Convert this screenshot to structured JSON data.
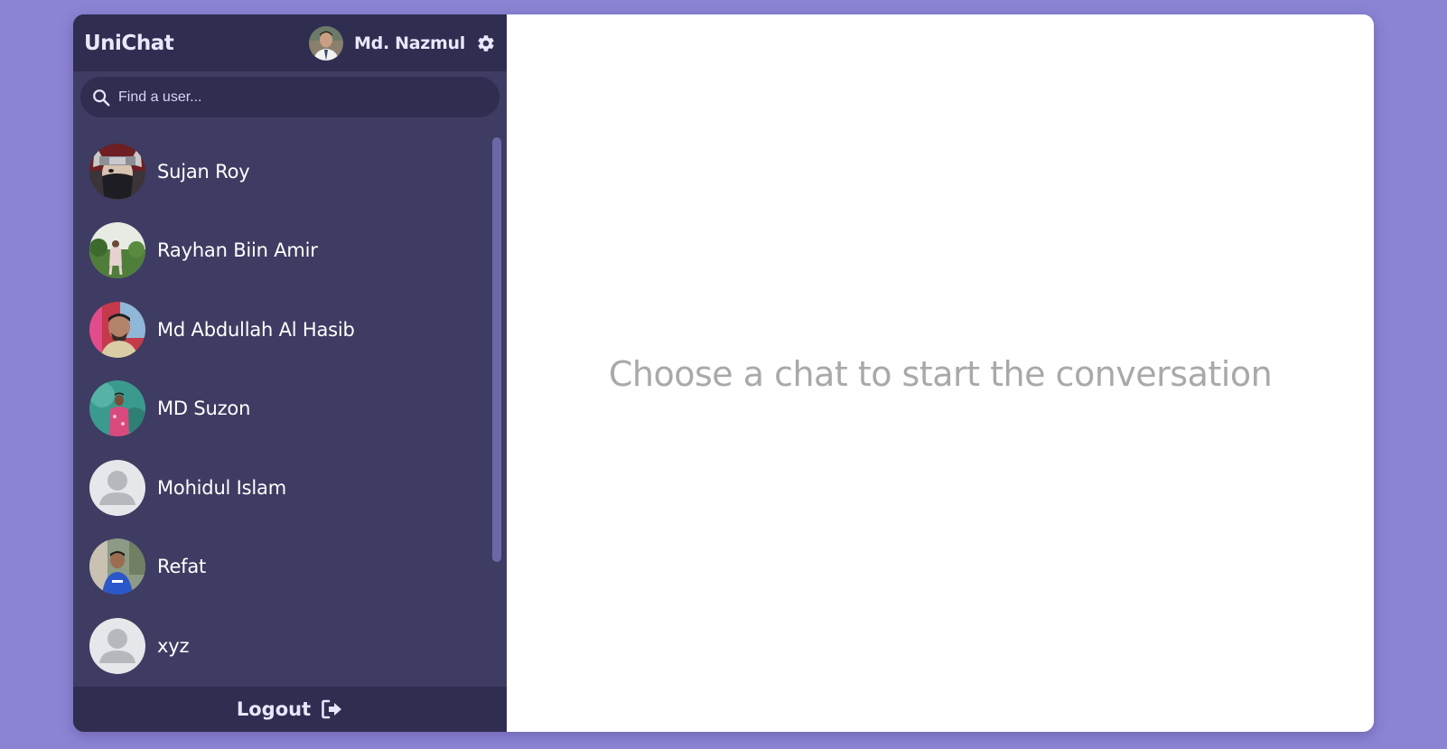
{
  "header": {
    "app_title": "UniChat",
    "current_user_name": "Md. Nazmul"
  },
  "search": {
    "placeholder": "Find a user..."
  },
  "users": [
    {
      "name": "Sujan Roy",
      "avatar": "photo"
    },
    {
      "name": "Rayhan Biin Amir",
      "avatar": "photo"
    },
    {
      "name": "Md Abdullah Al Hasib",
      "avatar": "photo"
    },
    {
      "name": "MD Suzon",
      "avatar": "photo"
    },
    {
      "name": "Mohidul Islam",
      "avatar": "default-person-icon"
    },
    {
      "name": "Refat",
      "avatar": "photo"
    },
    {
      "name": "xyz",
      "avatar": "default-person-icon"
    }
  ],
  "footer": {
    "logout_label": "Logout"
  },
  "main": {
    "empty_message": "Choose a chat to start the conversation"
  },
  "colors": {
    "page_background": "#8b84d3",
    "sidebar": "#3e3c62",
    "sidebar_bars": "#2f2d50",
    "main_panel": "#ffffff",
    "empty_message_text": "#a9a9a9"
  }
}
